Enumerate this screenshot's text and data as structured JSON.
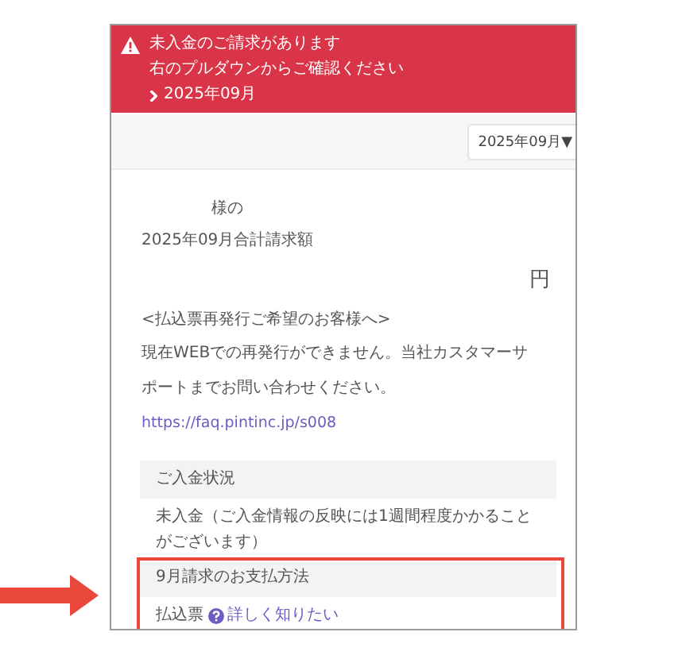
{
  "alert": {
    "lines": [
      "未入金のご請求があります",
      "右のプルダウンからご確認ください"
    ],
    "link": "2025年09月"
  },
  "month_select": {
    "value": "2025年09月",
    "caret": "▼"
  },
  "bill": {
    "customer_suffix": "様の",
    "title": "2025年09月合計請求額",
    "currency": "円"
  },
  "notice": {
    "heading": "<払込票再発行ご希望のお客様へ>",
    "body": "現在WEBでの再発行ができません。当社カスタマーサポートまでお問い合わせください。",
    "link": "https://faq.pintinc.jp/s008"
  },
  "sections": [
    {
      "heading": "ご入金状況",
      "body": "未入金（ご入金情報の反映には1週間程度かかることがございます）",
      "highlighted": false
    },
    {
      "heading": "9月請求のお支払方法",
      "body": "払込票",
      "link": "詳しく知りたい",
      "highlighted": true
    }
  ]
}
